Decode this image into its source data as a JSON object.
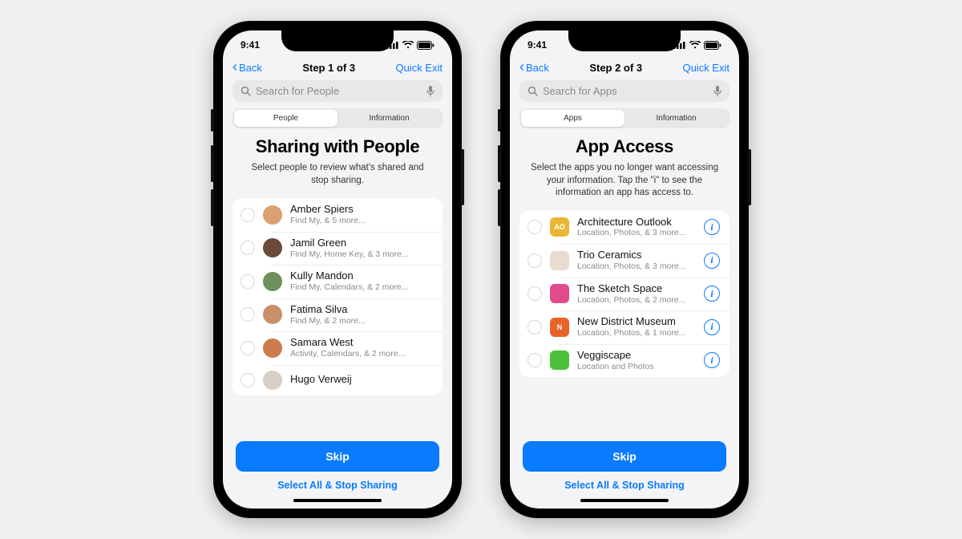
{
  "status": {
    "time": "9:41"
  },
  "left": {
    "nav": {
      "back": "Back",
      "title": "Step 1 of 3",
      "exit": "Quick Exit"
    },
    "search": {
      "placeholder": "Search for People"
    },
    "tabs": [
      "People",
      "Information"
    ],
    "active_tab": 0,
    "h1": "Sharing with People",
    "sub": "Select people to review what's shared and stop sharing.",
    "people": [
      {
        "name": "Amber Spiers",
        "detail": "Find My, & 5 more...",
        "avatar_bg": "#d9a071"
      },
      {
        "name": "Jamil Green",
        "detail": "Find My, Home Key, & 3 more...",
        "avatar_bg": "#6b4a3a"
      },
      {
        "name": "Kully Mandon",
        "detail": "Find My, Calendars, & 2 more...",
        "avatar_bg": "#6f8f5a"
      },
      {
        "name": "Fatima Silva",
        "detail": "Find My, & 2 more...",
        "avatar_bg": "#c98e6a"
      },
      {
        "name": "Samara West",
        "detail": "Activity, Calendars, & 2 more...",
        "avatar_bg": "#cc7b4f"
      },
      {
        "name": "Hugo Verweij",
        "detail": "",
        "avatar_bg": "#d7cfc5"
      }
    ],
    "footer": {
      "primary": "Skip",
      "secondary": "Select All & Stop Sharing"
    }
  },
  "right": {
    "nav": {
      "back": "Back",
      "title": "Step 2 of 3",
      "exit": "Quick Exit"
    },
    "search": {
      "placeholder": "Search for Apps"
    },
    "tabs": [
      "Apps",
      "Information"
    ],
    "active_tab": 0,
    "h1": "App Access",
    "sub": "Select the apps you no longer want accessing your information. Tap the \"i\" to see the information an app has access to.",
    "apps": [
      {
        "name": "Architecture Outlook",
        "detail": "Location, Photos, & 3 more...",
        "icon_bg": "#e9b635",
        "icon_text": "AO"
      },
      {
        "name": "Trio Ceramics",
        "detail": "Location, Photos, & 3 more...",
        "icon_bg": "#e7dccf",
        "icon_text": ""
      },
      {
        "name": "The Sketch Space",
        "detail": "Location, Photos, & 2 more...",
        "icon_bg": "#e14a8b",
        "icon_text": ""
      },
      {
        "name": "New District Museum",
        "detail": "Location, Photos, & 1 more...",
        "icon_bg": "#e8632a",
        "icon_text": "N"
      },
      {
        "name": "Veggiscape",
        "detail": "Location and Photos",
        "icon_bg": "#4cbf3b",
        "icon_text": ""
      }
    ],
    "footer": {
      "primary": "Skip",
      "secondary": "Select All & Stop Sharing"
    }
  }
}
